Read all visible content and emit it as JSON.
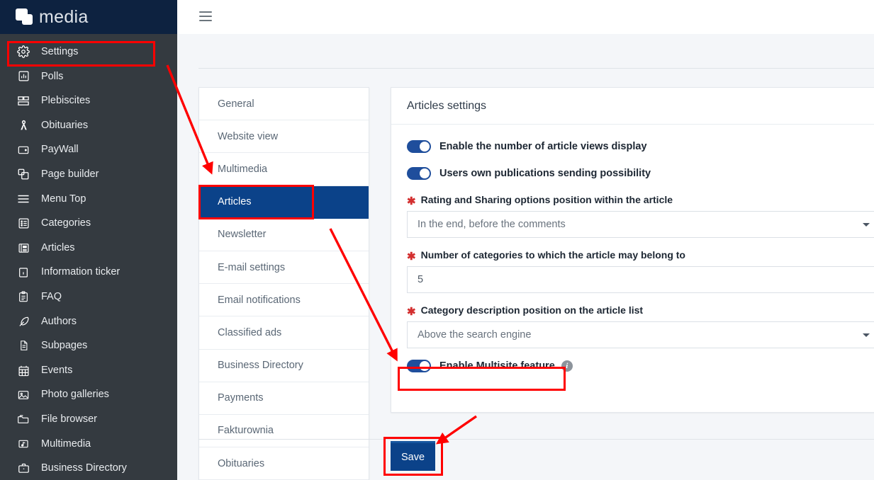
{
  "brand": {
    "logo_icon": "four-media-logo-icon",
    "name": "media"
  },
  "topbar": {
    "menu_icon": "hamburger-menu-icon"
  },
  "sidebar": {
    "items": [
      {
        "label": "Settings",
        "icon": "gear-icon"
      },
      {
        "label": "Polls",
        "icon": "bar-chart-icon"
      },
      {
        "label": "Plebiscites",
        "icon": "grid-layout-icon"
      },
      {
        "label": "Obituaries",
        "icon": "ribbon-icon"
      },
      {
        "label": "PayWall",
        "icon": "wallet-icon"
      },
      {
        "label": "Page builder",
        "icon": "copy-blocks-icon"
      },
      {
        "label": "Menu Top",
        "icon": "hamburger-lines-icon"
      },
      {
        "label": "Categories",
        "icon": "list-box-icon"
      },
      {
        "label": "Articles",
        "icon": "newspaper-icon"
      },
      {
        "label": "Information ticker",
        "icon": "info-square-icon"
      },
      {
        "label": "FAQ",
        "icon": "clipboard-icon"
      },
      {
        "label": "Authors",
        "icon": "feather-pen-icon"
      },
      {
        "label": "Subpages",
        "icon": "document-icon"
      },
      {
        "label": "Events",
        "icon": "calendar-icon"
      },
      {
        "label": "Photo galleries",
        "icon": "image-icon"
      },
      {
        "label": "File browser",
        "icon": "folder-icon"
      },
      {
        "label": "Multimedia",
        "icon": "music-frame-icon"
      },
      {
        "label": "Business Directory",
        "icon": "briefcase-icon"
      }
    ]
  },
  "settings_tabs": {
    "items": [
      {
        "label": "General",
        "active": false
      },
      {
        "label": "Website view",
        "active": false
      },
      {
        "label": "Multimedia",
        "active": false
      },
      {
        "label": "Articles",
        "active": true
      },
      {
        "label": "Newsletter",
        "active": false
      },
      {
        "label": "E-mail settings",
        "active": false
      },
      {
        "label": "Email notifications",
        "active": false
      },
      {
        "label": "Classified ads",
        "active": false
      },
      {
        "label": "Business Directory",
        "active": false
      },
      {
        "label": "Payments",
        "active": false
      },
      {
        "label": "Fakturownia",
        "active": false
      },
      {
        "label": "Obituaries",
        "active": false
      }
    ]
  },
  "settings_panel": {
    "title": "Articles settings",
    "toggles": [
      {
        "label": "Enable the number of article views display",
        "on": true
      },
      {
        "label": "Users own publications sending possibility",
        "on": true
      }
    ],
    "fields": [
      {
        "label": "Rating and Sharing options position within the article",
        "required": true,
        "type": "select",
        "value": "In the end, before the comments",
        "caret_icon": "chevron-down-icon"
      },
      {
        "label": "Number of categories to which the article may belong to",
        "required": true,
        "type": "input",
        "value": "5"
      },
      {
        "label": "Category description position on the article list",
        "required": true,
        "type": "select",
        "value": "Above the search engine",
        "caret_icon": "chevron-down-icon"
      }
    ],
    "multisite": {
      "label": "Enable Multisite feature",
      "on": true,
      "info_icon": "info-circle-icon"
    }
  },
  "footer": {
    "save_label": "Save"
  },
  "annotation": {
    "color": "#ff0000",
    "highlight_boxes": [
      "settings-sidebar-item",
      "articles-tab",
      "enable-multisite-toggle",
      "save-button"
    ],
    "arrows": 3
  }
}
